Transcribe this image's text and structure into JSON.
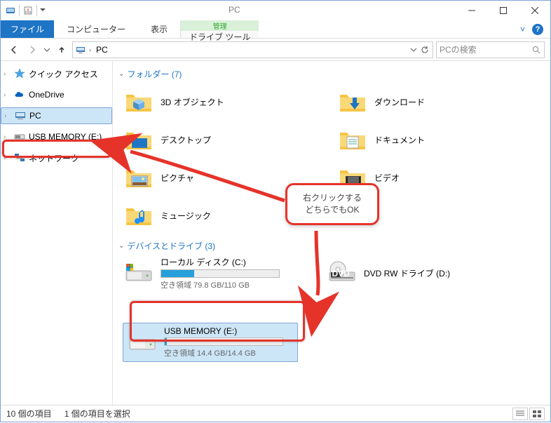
{
  "window": {
    "title": "PC"
  },
  "ribbon": {
    "file": "ファイル",
    "computer": "コンピューター",
    "view": "表示",
    "context_group": "管理",
    "context_tab": "ドライブ ツール"
  },
  "address": {
    "crumb1": "PC",
    "refresh_icon": "↻"
  },
  "search": {
    "placeholder": "PCの検索"
  },
  "nav": {
    "quick": "クイック アクセス",
    "onedrive": "OneDrive",
    "pc": "PC",
    "usb": "USB MEMORY (E:)",
    "network": "ネットワーク"
  },
  "sections": {
    "folders": "フォルダー (7)",
    "drives": "デバイスとドライブ (3)"
  },
  "folders": {
    "f0": "3D オブジェクト",
    "f1": "ダウンロード",
    "f2": "デスクトップ",
    "f3": "ドキュメント",
    "f4": "ピクチャ",
    "f5": "ビデオ",
    "f6": "ミュージック"
  },
  "drives": {
    "d0": {
      "name": "ローカル ディスク (C:)",
      "free": "空き領域 79.8 GB/110 GB",
      "fill_pct": 28
    },
    "d1": {
      "name": "DVD RW ドライブ (D:)"
    },
    "d2": {
      "name": "USB MEMORY (E:)",
      "free": "空き領域 14.4 GB/14.4 GB",
      "fill_pct": 2
    }
  },
  "status": {
    "count": "10 個の項目",
    "selected": "1 個の項目を選択"
  },
  "annotation": {
    "line1": "右クリックする",
    "line2": "どちらでもOK"
  }
}
